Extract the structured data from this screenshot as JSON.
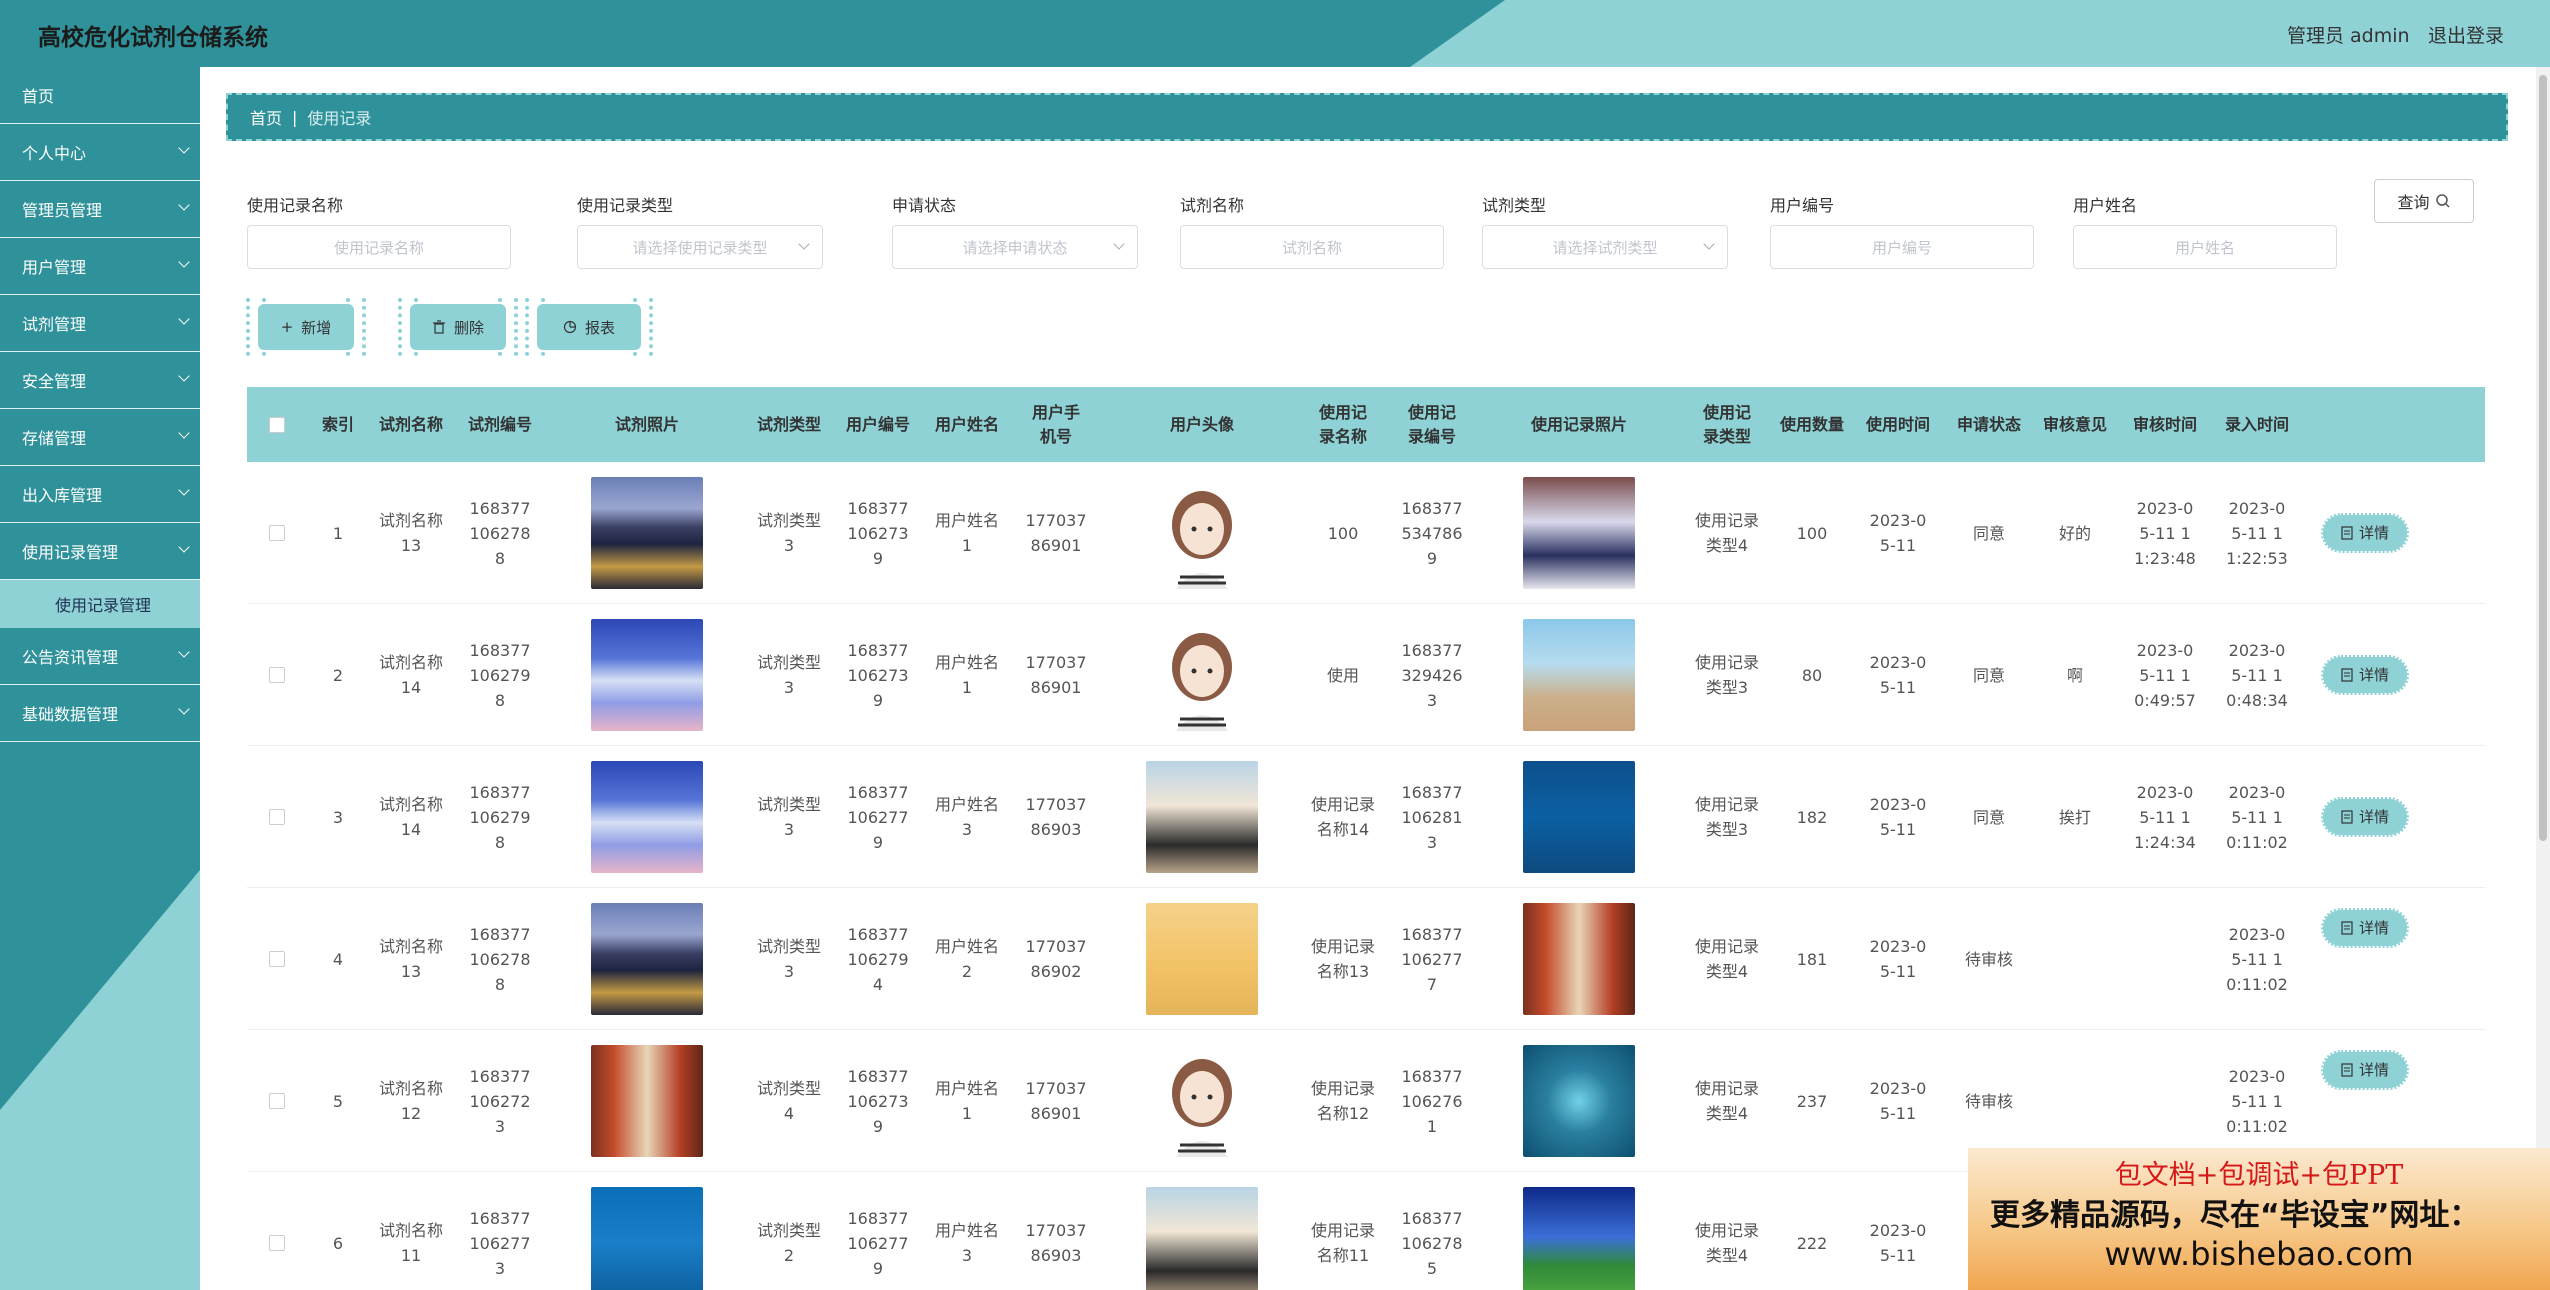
{
  "header": {
    "title": "高校危化试剂仓储系统",
    "user": "管理员 admin",
    "logout": "退出登录"
  },
  "sidebar": {
    "items": [
      {
        "label": "首页",
        "chevron": false
      },
      {
        "label": "个人中心",
        "chevron": true
      },
      {
        "label": "管理员管理",
        "chevron": true
      },
      {
        "label": "用户管理",
        "chevron": true
      },
      {
        "label": "试剂管理",
        "chevron": true
      },
      {
        "label": "安全管理",
        "chevron": true
      },
      {
        "label": "存储管理",
        "chevron": true
      },
      {
        "label": "出入库管理",
        "chevron": true
      },
      {
        "label": "使用记录管理",
        "chevron": true
      }
    ],
    "sub_item": "使用记录管理",
    "items_after": [
      {
        "label": "公告资讯管理",
        "chevron": true
      },
      {
        "label": "基础数据管理",
        "chevron": true
      }
    ]
  },
  "breadcrumb": {
    "home": "首页",
    "separator": "|",
    "current": "使用记录"
  },
  "filters": {
    "record_name": {
      "label": "使用记录名称",
      "placeholder": "使用记录名称"
    },
    "record_type": {
      "label": "使用记录类型",
      "placeholder": "请选择使用记录类型"
    },
    "apply_status": {
      "label": "申请状态",
      "placeholder": "请选择申请状态"
    },
    "reagent_name": {
      "label": "试剂名称",
      "placeholder": "试剂名称"
    },
    "reagent_type": {
      "label": "试剂类型",
      "placeholder": "请选择试剂类型"
    },
    "user_no": {
      "label": "用户编号",
      "placeholder": "用户编号"
    },
    "user_name": {
      "label": "用户姓名",
      "placeholder": "用户姓名"
    },
    "search_label": "查询",
    "search_icon": "search-icon"
  },
  "actions": {
    "add": {
      "label": "新增",
      "icon": "plus-icon"
    },
    "delete": {
      "label": "删除",
      "icon": "trash-icon"
    },
    "report": {
      "label": "报表",
      "icon": "pie-chart-icon"
    }
  },
  "table": {
    "headers": [
      "索引",
      "试剂名称",
      "试剂编号",
      "试剂照片",
      "试剂类型",
      "用户编号",
      "用户姓名",
      "用户手机号",
      "用户头像",
      "使用记录名称",
      "使用记录编号",
      "使用记录照片",
      "使用记录类型",
      "使用数量",
      "使用时间",
      "申请状态",
      "审核意见",
      "审核时间",
      "录入时间"
    ],
    "detail_label": "详情",
    "rows": [
      {
        "index": "1",
        "reagent_name": "试剂名称13",
        "reagent_no": "1683771062788",
        "reagent_photo": "city-photo",
        "reagent_type": "试剂类型3",
        "user_no": "1683771062739",
        "user_name": "用户姓名1",
        "phone": "17703786901",
        "avatar": "girl-avatar",
        "record_name": "100",
        "record_no": "1683775347869",
        "record_photo": "team-photo",
        "record_type": "使用记录类型4",
        "quantity": "100",
        "use_time": "2023-05-11",
        "status": "同意",
        "opinion": "好的",
        "review_time": "2023-05-11 11:23:48",
        "entry_time": "2023-05-11 11:22:53"
      },
      {
        "index": "2",
        "reagent_name": "试剂名称14",
        "reagent_no": "1683771062798",
        "reagent_photo": "sky-photo",
        "reagent_type": "试剂类型3",
        "user_no": "1683771062739",
        "user_name": "用户姓名1",
        "phone": "17703786901",
        "avatar": "girl-avatar",
        "record_name": "使用",
        "record_no": "1683773294263",
        "record_photo": "beach-photo",
        "record_type": "使用记录类型3",
        "quantity": "80",
        "use_time": "2023-05-11",
        "status": "同意",
        "opinion": "啊",
        "review_time": "2023-05-11 10:49:57",
        "entry_time": "2023-05-11 10:48:34"
      },
      {
        "index": "3",
        "reagent_name": "试剂名称14",
        "reagent_no": "1683771062798",
        "reagent_photo": "sky-photo",
        "reagent_type": "试剂类型3",
        "user_no": "1683771062779",
        "user_name": "用户姓名3",
        "phone": "17703786903",
        "avatar": "boy-avatar",
        "record_name": "使用记录名称14",
        "record_no": "1683771062813",
        "record_photo": "ocean-photo",
        "record_type": "使用记录类型3",
        "quantity": "182",
        "use_time": "2023-05-11",
        "status": "同意",
        "opinion": "挨打",
        "review_time": "2023-05-11 11:24:34",
        "entry_time": "2023-05-11 10:11:02"
      },
      {
        "index": "4",
        "reagent_name": "试剂名称13",
        "reagent_no": "1683771062788",
        "reagent_photo": "city-photo",
        "reagent_type": "试剂类型3",
        "user_no": "1683771062794",
        "user_name": "用户姓名2",
        "phone": "17703786902",
        "avatar": "conan-avatar",
        "record_name": "使用记录名称13",
        "record_no": "1683771062777",
        "record_photo": "corridor-photo",
        "record_type": "使用记录类型4",
        "quantity": "181",
        "use_time": "2023-05-11",
        "status": "待审核",
        "opinion": "",
        "review_time": "",
        "entry_time": "2023-05-11 10:11:02"
      },
      {
        "index": "5",
        "reagent_name": "试剂名称12",
        "reagent_no": "1683771062723",
        "reagent_photo": "corridor-photo",
        "reagent_type": "试剂类型4",
        "user_no": "1683771062739",
        "user_name": "用户姓名1",
        "phone": "17703786901",
        "avatar": "girl-avatar",
        "record_name": "使用记录名称12",
        "record_no": "1683771062761",
        "record_photo": "heart-photo",
        "record_type": "使用记录类型4",
        "quantity": "237",
        "use_time": "2023-05-11",
        "status": "待审核",
        "opinion": "",
        "review_time": "",
        "entry_time": "2023-05-11 10:11:02"
      },
      {
        "index": "6",
        "reagent_name": "试剂名称11",
        "reagent_no": "1683771062773",
        "reagent_photo": "sea-photo",
        "reagent_type": "试剂类型2",
        "user_no": "1683771062779",
        "user_name": "用户姓名3",
        "phone": "17703786903",
        "avatar": "boy-avatar",
        "record_name": "使用记录名称11",
        "record_no": "1683771062785",
        "record_photo": "field-photo",
        "record_type": "使用记录类型4",
        "quantity": "222",
        "use_time": "2023-05-11",
        "status": "",
        "opinion": "",
        "review_time": "",
        "entry_time": ""
      }
    ]
  },
  "ad": {
    "line1": "包文档+包调试+包PPT",
    "line2": "更多精品源码，尽在“毕设宝”网址：",
    "line3": "www.bishebao.com"
  },
  "colors": {
    "primary": "#2f929a",
    "accent": "#8ed2d6"
  }
}
